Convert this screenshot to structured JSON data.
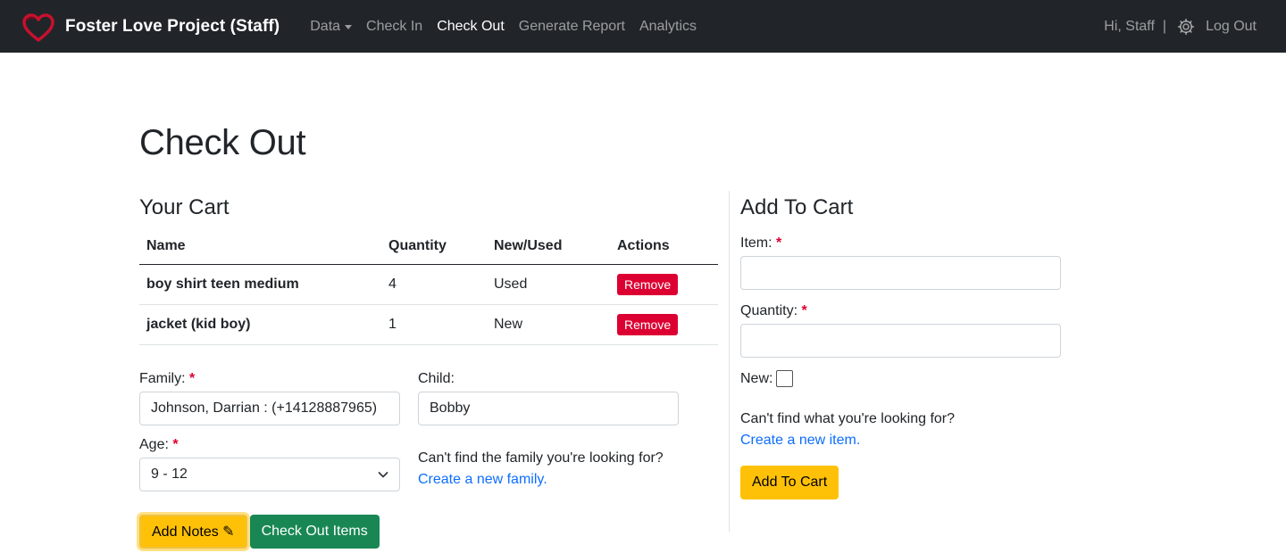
{
  "nav": {
    "brand": "Foster Love Project (Staff)",
    "links": [
      {
        "label": "Data"
      },
      {
        "label": "Check In"
      },
      {
        "label": "Check Out"
      },
      {
        "label": "Generate Report"
      },
      {
        "label": "Analytics"
      }
    ],
    "active_link": "Check Out",
    "greeting": "Hi, Staff",
    "separator": "|",
    "logout": "Log Out",
    "colors": {
      "bar": "#212529",
      "logo": "#c8102e"
    }
  },
  "page": {
    "title": "Check Out"
  },
  "cart": {
    "heading": "Your Cart",
    "columns": [
      "Name",
      "Quantity",
      "New/Used",
      "Actions"
    ],
    "rows": [
      {
        "name": "boy shirt teen medium",
        "quantity": "4",
        "condition": "Used",
        "action": "Remove"
      },
      {
        "name": "jacket (kid boy)",
        "quantity": "1",
        "condition": "New",
        "action": "Remove"
      }
    ]
  },
  "form": {
    "family_label": "Family:",
    "family_value": "Johnson, Darrian : (+14128887965)",
    "child_label": "Child:",
    "child_value": "Bobby",
    "age_label": "Age:",
    "age_value": "9 - 12",
    "family_help": "Can't find the family you're looking for?",
    "family_link": "Create a new family.",
    "required_mark": "*",
    "notes_button": "Add Notes ✎",
    "checkout_button": "Check Out Items"
  },
  "add_to_cart": {
    "heading": "Add To Cart",
    "item_label": "Item:",
    "item_value": "",
    "quantity_label": "Quantity:",
    "quantity_value": "",
    "new_label": "New:",
    "new_checked": false,
    "help": "Can't find what you're looking for?",
    "link": "Create a new item.",
    "button": "Add To Cart"
  },
  "colors": {
    "danger": "#dc0032",
    "warning": "#ffc107",
    "success": "#198754",
    "link": "#0d6efd"
  }
}
